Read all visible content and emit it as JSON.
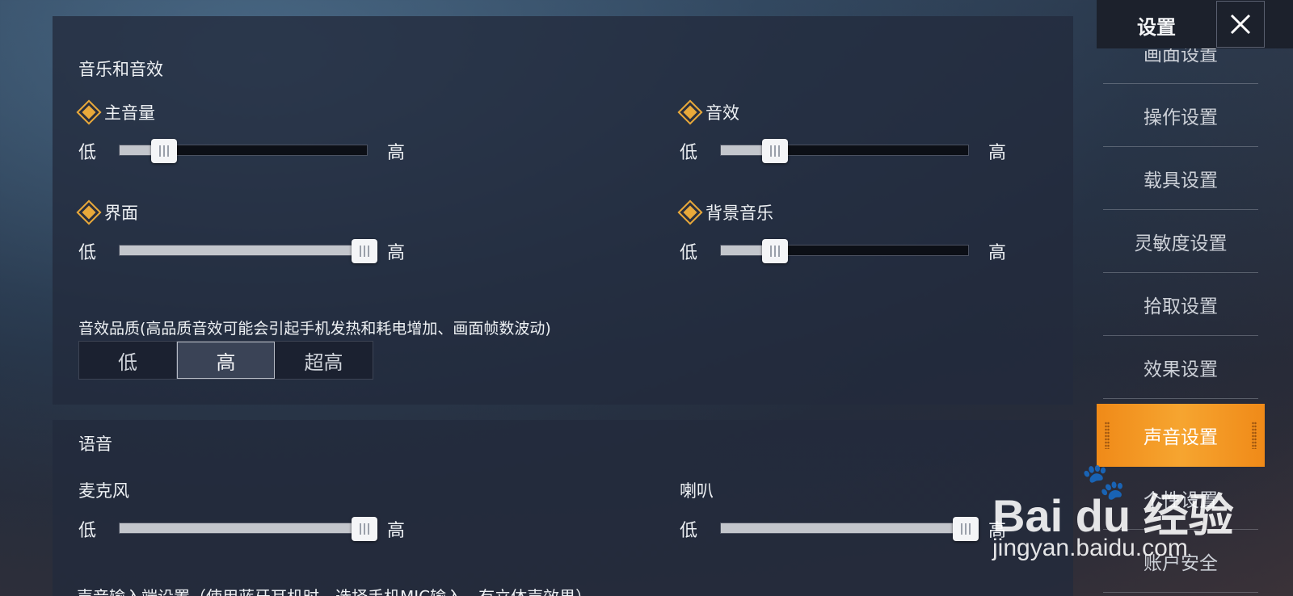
{
  "audio_section": {
    "title": "音乐和音效",
    "lo": "低",
    "hi": "高",
    "sliders": [
      {
        "label": "主音量",
        "value": 0.18
      },
      {
        "label": "音效",
        "value": 0.22
      },
      {
        "label": "界面",
        "value": 0.99
      },
      {
        "label": "背景音乐",
        "value": 0.22
      }
    ],
    "quality_note": "音效品质(高品质音效可能会引起手机发热和耗电增加、画面帧数波动)",
    "quality_options": [
      "低",
      "高",
      "超高"
    ],
    "quality_selected": "高"
  },
  "voice_section": {
    "title": "语音",
    "lo": "低",
    "hi": "高",
    "sliders": [
      {
        "label": "麦克风",
        "value": 0.99
      },
      {
        "label": "喇叭",
        "value": 0.99
      }
    ],
    "input_setting": "声音输入端设置（使用蓝牙耳机时，选择手机MIC输入，有立体声效果）"
  },
  "sidebar": {
    "title": "设置",
    "close_icon": "close-icon",
    "items": [
      "画面设置",
      "操作设置",
      "载具设置",
      "灵敏度设置",
      "拾取设置",
      "效果设置",
      "声音设置",
      "个性设置",
      "账户安全"
    ],
    "active": "声音设置"
  },
  "watermark": {
    "main": "Bai du 经验",
    "sub": "jingyan.baidu.com"
  },
  "colors": {
    "accent": "#f6a530",
    "diamond": "#e9a93a",
    "panel": "#232a3c"
  }
}
